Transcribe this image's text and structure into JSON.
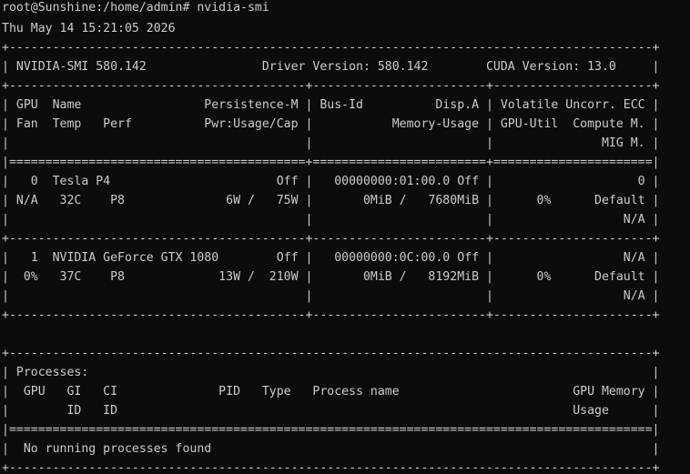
{
  "terminal": {
    "prompt": "root@Sunshine:/home/admin# nvidia-smi",
    "lines": [
      "Thu May 14 15:21:05 2026",
      "+-----------------------------------------------------------------------------------------+",
      "| NVIDIA-SMI 580.142                Driver Version: 580.142        CUDA Version: 13.0     |",
      "+-----------------------------------------+------------------------+----------------------+",
      "| GPU  Name                 Persistence-M | Bus-Id          Disp.A | Volatile Uncorr. ECC |",
      "| Fan  Temp   Perf          Pwr:Usage/Cap |           Memory-Usage | GPU-Util  Compute M. |",
      "|                                         |                        |               MIG M. |",
      "|=========================================+========================+======================|",
      "|   0  Tesla P4                       Off |   00000000:01:00.0 Off |                    0 |",
      "| N/A   32C    P8              6W /   75W |       0MiB /   7680MiB |      0%      Default |",
      "|                                         |                        |                  N/A |",
      "+-----------------------------------------+------------------------+----------------------+",
      "|   1  NVIDIA GeForce GTX 1080        Off |   00000000:0C:00.0 Off |                  N/A |",
      "|  0%   37C    P8             13W /  210W |       0MiB /   8192MiB |      0%      Default |",
      "|                                         |                        |                  N/A |",
      "+-----------------------------------------+------------------------+----------------------+",
      "",
      "+-----------------------------------------------------------------------------------------+",
      "| Processes:                                                                              |",
      "|  GPU   GI   CI              PID   Type   Process name                        GPU Memory |",
      "|        ID   ID                                                               Usage      |",
      "|=========================================================================================|",
      "|  No running processes found                                                             |",
      "+-----------------------------------------------------------------------------------------+"
    ]
  }
}
